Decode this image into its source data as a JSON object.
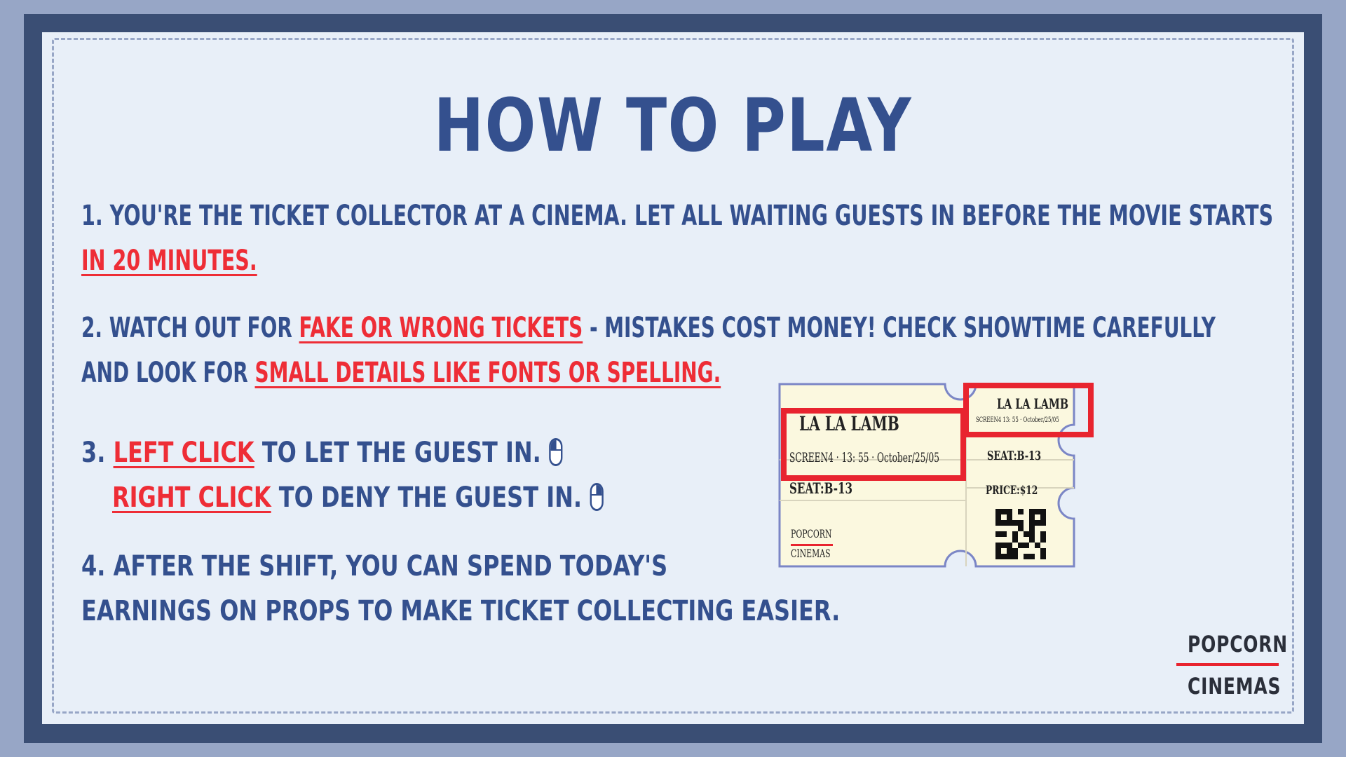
{
  "title": "HOW TO PLAY",
  "steps": {
    "s1_part1": "1. YOU'RE THE TICKET COLLECTOR AT A CINEMA. LET ALL WAITING GUESTS IN BEFORE THE MOVIE STARTS",
    "s1_hl": "IN 20 MINUTES.",
    "s2_part1": "2. WATCH OUT FOR ",
    "s2_hl1": "FAKE OR WRONG TICKETS",
    "s2_part2": " - MISTAKES COST MONEY! CHECK SHOWTIME CAREFULLY",
    "s2_part3": "AND LOOK FOR ",
    "s2_hl2": "SMALL DETAILS LIKE FONTS OR SPELLING.",
    "s3_prefix": "3. ",
    "s3_hl1": "LEFT CLICK",
    "s3_rest1": " TO LET THE GUEST IN.",
    "s3_hl2": "RIGHT CLICK",
    "s3_rest2": " TO DENY THE GUEST IN.",
    "s4_line1": "4. AFTER THE SHIFT, YOU CAN SPEND TODAY'S",
    "s4_line2": "EARNINGS ON PROPS TO MAKE TICKET COLLECTING EASIER."
  },
  "ticket": {
    "movie_title": "LA LA LAMB",
    "screen_info": "SCREEN4 · 13: 55 · October/25/05",
    "seat": "SEAT:B-13",
    "stub_title": "LA LA LAMB",
    "stub_screen_info": "SCREEN4 13: 55 · October/25/05",
    "stub_seat": "SEAT:B-13",
    "stub_price": "PRICE:$12",
    "brand_line1": "POPCORN",
    "brand_line2": "CINEMAS"
  },
  "logo": {
    "line1": "POPCORN",
    "line2": "CINEMAS"
  },
  "colors": {
    "primary_text": "#34508e",
    "highlight": "#ee2d36",
    "ticket_fill": "#fbf8df",
    "ticket_outline": "#7b86c6"
  },
  "icons": [
    "left-mouse-icon",
    "right-mouse-icon",
    "qr-code-icon"
  ]
}
